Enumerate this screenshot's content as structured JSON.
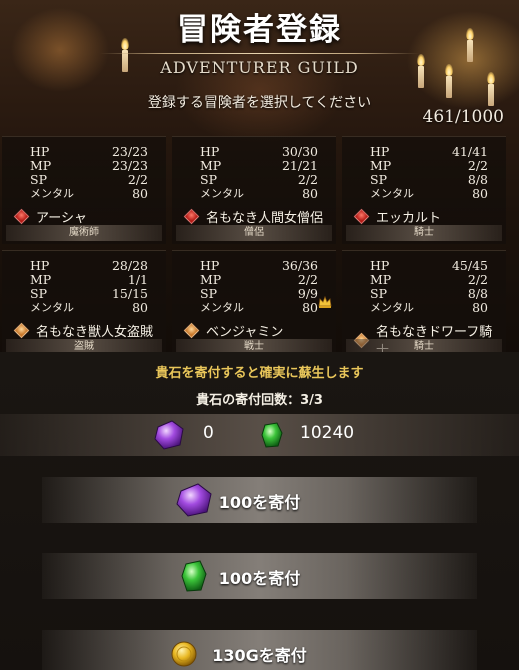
{
  "header": {
    "title": "冒険者登録",
    "subtitle": "ADVENTURER GUILD",
    "instruction": "登録する冒険者を選択してください",
    "count": "461/1000"
  },
  "stat_labels": {
    "hp": "HP",
    "mp": "MP",
    "sp": "SP",
    "mental": "メンタル"
  },
  "adventurers": [
    {
      "hp": "23/23",
      "mp": "23/23",
      "sp": "2/2",
      "mental": "80",
      "name": "アーシャ",
      "class": "魔術師",
      "icon": "red-diamond-icon"
    },
    {
      "hp": "30/30",
      "mp": "21/21",
      "sp": "2/2",
      "mental": "80",
      "name": "名もなき人間女僧侶",
      "class": "僧侶",
      "icon": "red-diamond-icon"
    },
    {
      "hp": "41/41",
      "mp": "2/2",
      "sp": "8/8",
      "mental": "80",
      "name": "エッカルト",
      "class": "騎士",
      "icon": "red-diamond-icon"
    },
    {
      "hp": "28/28",
      "mp": "1/1",
      "sp": "15/15",
      "mental": "80",
      "name": "名もなき獣人女盗賊",
      "class": "盗賊",
      "icon": "orange-diamond-icon"
    },
    {
      "hp": "36/36",
      "mp": "2/2",
      "sp": "9/9",
      "mental": "80",
      "name": "ベンジャミン",
      "class": "戦士",
      "icon": "orange-diamond-icon"
    },
    {
      "hp": "45/45",
      "mp": "2/2",
      "sp": "8/8",
      "mental": "80",
      "name": "名もなきドワーフ騎士",
      "class": "騎士",
      "icon": "orange-diamond-icon"
    }
  ],
  "donation": {
    "notice": "貴石を寄付すると確実に蘇生します",
    "count_text": "貴石の寄付回数：3/3",
    "purple_gems": "0",
    "green_gems": "10240",
    "buttons": [
      {
        "label": "100を寄付",
        "icon": "purple-gem-icon"
      },
      {
        "label": "100を寄付",
        "icon": "green-gem-icon"
      },
      {
        "label": "130Gを寄付",
        "icon": "gold-coin-icon"
      }
    ]
  },
  "colors": {
    "notice": "#e9c65a",
    "red_icon": "#b51b16",
    "orange_icon": "#c9782a",
    "purple_gem": "#a24be0",
    "green_gem": "#3cc43a",
    "gold": "#e9b823"
  }
}
